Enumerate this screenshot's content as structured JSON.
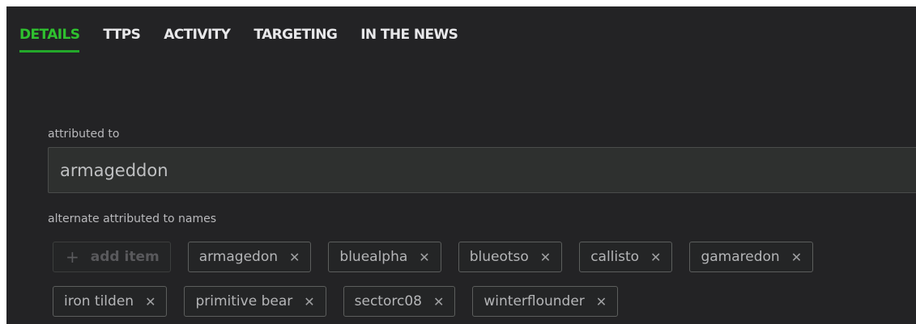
{
  "tabs": [
    {
      "label": "DETAILS",
      "active": true
    },
    {
      "label": "TTPS",
      "active": false
    },
    {
      "label": "ACTIVITY",
      "active": false
    },
    {
      "label": "TARGETING",
      "active": false
    },
    {
      "label": "IN THE NEWS",
      "active": false
    }
  ],
  "attributed": {
    "label": "attributed to",
    "value": "armageddon"
  },
  "alternate": {
    "label": "alternate attributed to names",
    "add_label": "add item",
    "add_icon": "plus-icon",
    "remove_icon": "close-icon",
    "items": [
      "armagedon",
      "bluealpha",
      "blueotso",
      "callisto",
      "gamaredon",
      "iron tilden",
      "primitive bear",
      "sectorc08",
      "winterflounder"
    ]
  },
  "colors": {
    "accent": "#2fc12f",
    "background": "#232325"
  }
}
